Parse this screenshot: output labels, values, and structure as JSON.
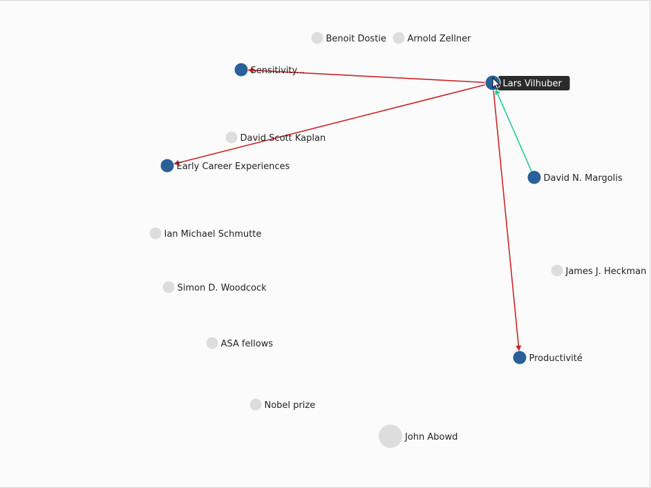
{
  "colors": {
    "active_node": "#2a6099",
    "inactive_node": "#dddddd",
    "outgoing_edge": "#cc2222",
    "incoming_edge": "#22cc99",
    "tooltip_bg": "#2b2b2b",
    "tooltip_text": "#ffffff"
  },
  "graph": {
    "nodes": [
      {
        "id": "benoit-dostie",
        "label": "Benoit Dostie",
        "active": false,
        "weight": 1
      },
      {
        "id": "arnold-zellner",
        "label": "Arnold Zellner",
        "active": false,
        "weight": 1
      },
      {
        "id": "sensitivity",
        "label": "Sensitivity...",
        "active": true,
        "weight": 1
      },
      {
        "id": "lars-vilhuber",
        "label": "Lars Vilhuber",
        "active": true,
        "weight": 1,
        "hovered": true
      },
      {
        "id": "david-scott-kaplan",
        "label": "David Scott Kaplan",
        "active": false,
        "weight": 1
      },
      {
        "id": "early-career",
        "label": "Early Career Experiences",
        "active": true,
        "weight": 1
      },
      {
        "id": "david-margolis",
        "label": "David N. Margolis",
        "active": true,
        "weight": 1
      },
      {
        "id": "ian-schmutte",
        "label": "Ian Michael Schmutte",
        "active": false,
        "weight": 1
      },
      {
        "id": "james-heckman",
        "label": "James J. Heckman",
        "active": false,
        "weight": 1
      },
      {
        "id": "simon-woodcock",
        "label": "Simon D. Woodcock",
        "active": false,
        "weight": 1
      },
      {
        "id": "asa-fellows",
        "label": "ASA fellows",
        "active": false,
        "weight": 1
      },
      {
        "id": "productivite",
        "label": "Productivité",
        "active": true,
        "weight": 1
      },
      {
        "id": "nobel-prize",
        "label": "Nobel prize",
        "active": false,
        "weight": 1
      },
      {
        "id": "john-abowd",
        "label": "John Abowd",
        "active": false,
        "weight": 2
      }
    ],
    "edges": [
      {
        "source": "lars-vilhuber",
        "target": "sensitivity",
        "kind": "outgoing"
      },
      {
        "source": "lars-vilhuber",
        "target": "early-career",
        "kind": "outgoing"
      },
      {
        "source": "lars-vilhuber",
        "target": "productivite",
        "kind": "outgoing"
      },
      {
        "source": "david-margolis",
        "target": "lars-vilhuber",
        "kind": "incoming"
      }
    ],
    "tooltip": {
      "node": "lars-vilhuber",
      "text": "Lars Vilhuber"
    },
    "cursor": "pointer-arrow-icon"
  }
}
